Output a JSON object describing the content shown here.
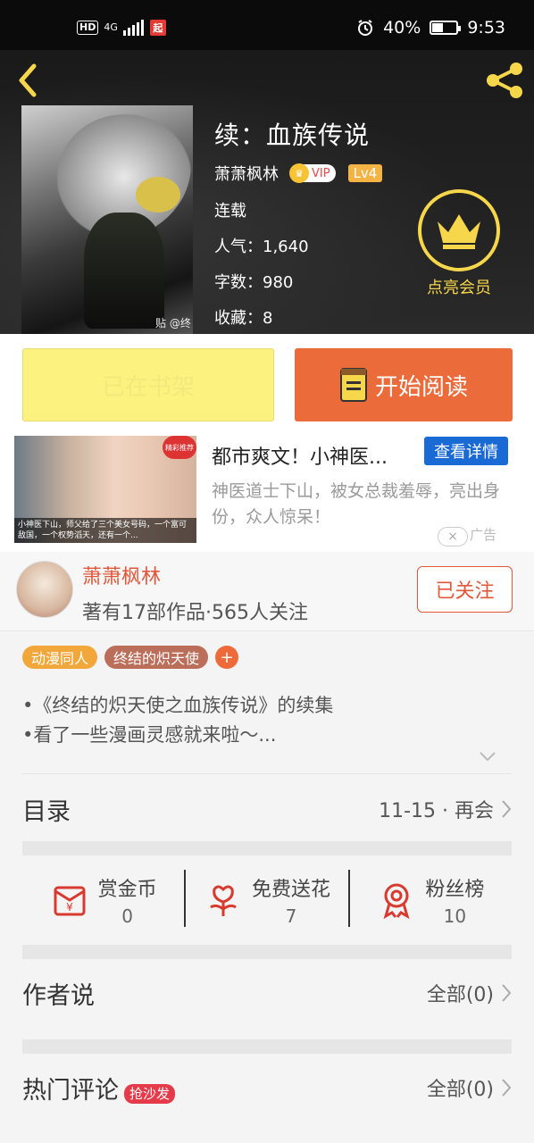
{
  "status_bar": {
    "hd": "HD",
    "network": "4G",
    "app_badge": "起",
    "battery": "40%",
    "time": "9:53"
  },
  "book": {
    "title": "续：血族传说",
    "author": "萧萧枫林",
    "vip_label": "VIP",
    "level": "Lv4",
    "status": "连载",
    "popularity_label": "人气：",
    "popularity": "1,640",
    "words_label": "字数：",
    "words": "980",
    "favorites_label": "收藏：",
    "favorites": "8",
    "cover_watermark": "贴 @终"
  },
  "member": {
    "label": "点亮会员"
  },
  "actions": {
    "shelf_label": "已在书架",
    "read_label": "开始阅读"
  },
  "ad": {
    "title": "都市爽文！小神医...",
    "button": "查看详情",
    "description": "神医道士下山，被女总裁羞辱，亮出身份，众人惊呆！",
    "image_caption": "小神医下山，师父给了三个美女号码，一个富可敌国，一个权势滔天，还有一个...",
    "image_tag": "精彩推荐",
    "close": "×",
    "mark": "广告"
  },
  "author_card": {
    "name": "萧萧枫林",
    "info": "著有17部作品·565人关注",
    "follow_label": "已关注"
  },
  "tags": [
    "动漫同人",
    "终结的炽天使"
  ],
  "tag_add": "+",
  "intro": {
    "line1": "•《终结的炽天使之血族传说》的续集",
    "line2": "•看了一些漫画灵感就来啦～..."
  },
  "catalog": {
    "label": "目录",
    "latest": "11-15 · 再会"
  },
  "stats": [
    {
      "label": "赏金币",
      "value": "0"
    },
    {
      "label": "免费送花",
      "value": "7"
    },
    {
      "label": "粉丝榜",
      "value": "10"
    }
  ],
  "author_says": {
    "label": "作者说",
    "value": "全部(0)"
  },
  "hot_comments": {
    "label": "热门评论",
    "badge": "抢沙发",
    "value": "全部(0)"
  },
  "colors": {
    "accent": "#ec6b3b",
    "gold": "#f6d64a",
    "author_red": "#e0573a",
    "ad_blue": "#1a6ad6"
  }
}
